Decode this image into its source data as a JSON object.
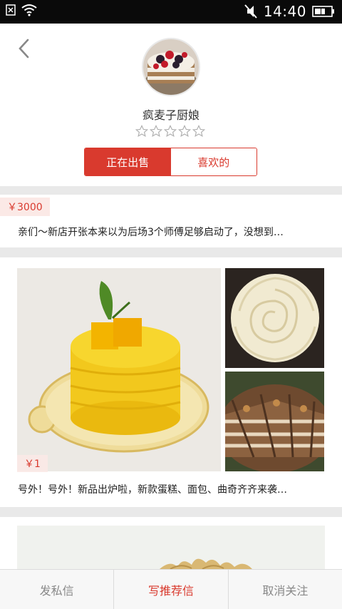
{
  "status_bar": {
    "time": "14:40",
    "icons": [
      "notification-icon",
      "wifi-icon",
      "mute-icon",
      "battery-icon"
    ]
  },
  "header": {
    "back_icon": "chevron-left-icon",
    "avatar": "cake-avatar",
    "name": "疯麦子厨娘",
    "rating": {
      "value": 0,
      "max": 5
    },
    "tabs": [
      {
        "label": "正在出售",
        "active": true
      },
      {
        "label": "喜欢的",
        "active": false
      }
    ]
  },
  "posts": [
    {
      "price": "￥3000",
      "text": "亲们～新店开张本来以为后场3个师傅足够启动了，没想到…"
    },
    {
      "price": "￥1",
      "text": "号外！号外！新品出炉啦，新款蛋糕、面包、曲奇齐齐来袭…",
      "images": [
        "mango-mousse-cake",
        "cream-rose-cupcake",
        "chocolate-layer-cake-slices"
      ]
    },
    {
      "images": [
        "pastry-partial"
      ]
    }
  ],
  "bottom_bar": {
    "buttons": [
      {
        "label": "发私信"
      },
      {
        "label": "写推荐信"
      },
      {
        "label": "取消关注"
      }
    ]
  },
  "colors": {
    "accent": "#d93a2e",
    "background": "#e9e9e9"
  }
}
